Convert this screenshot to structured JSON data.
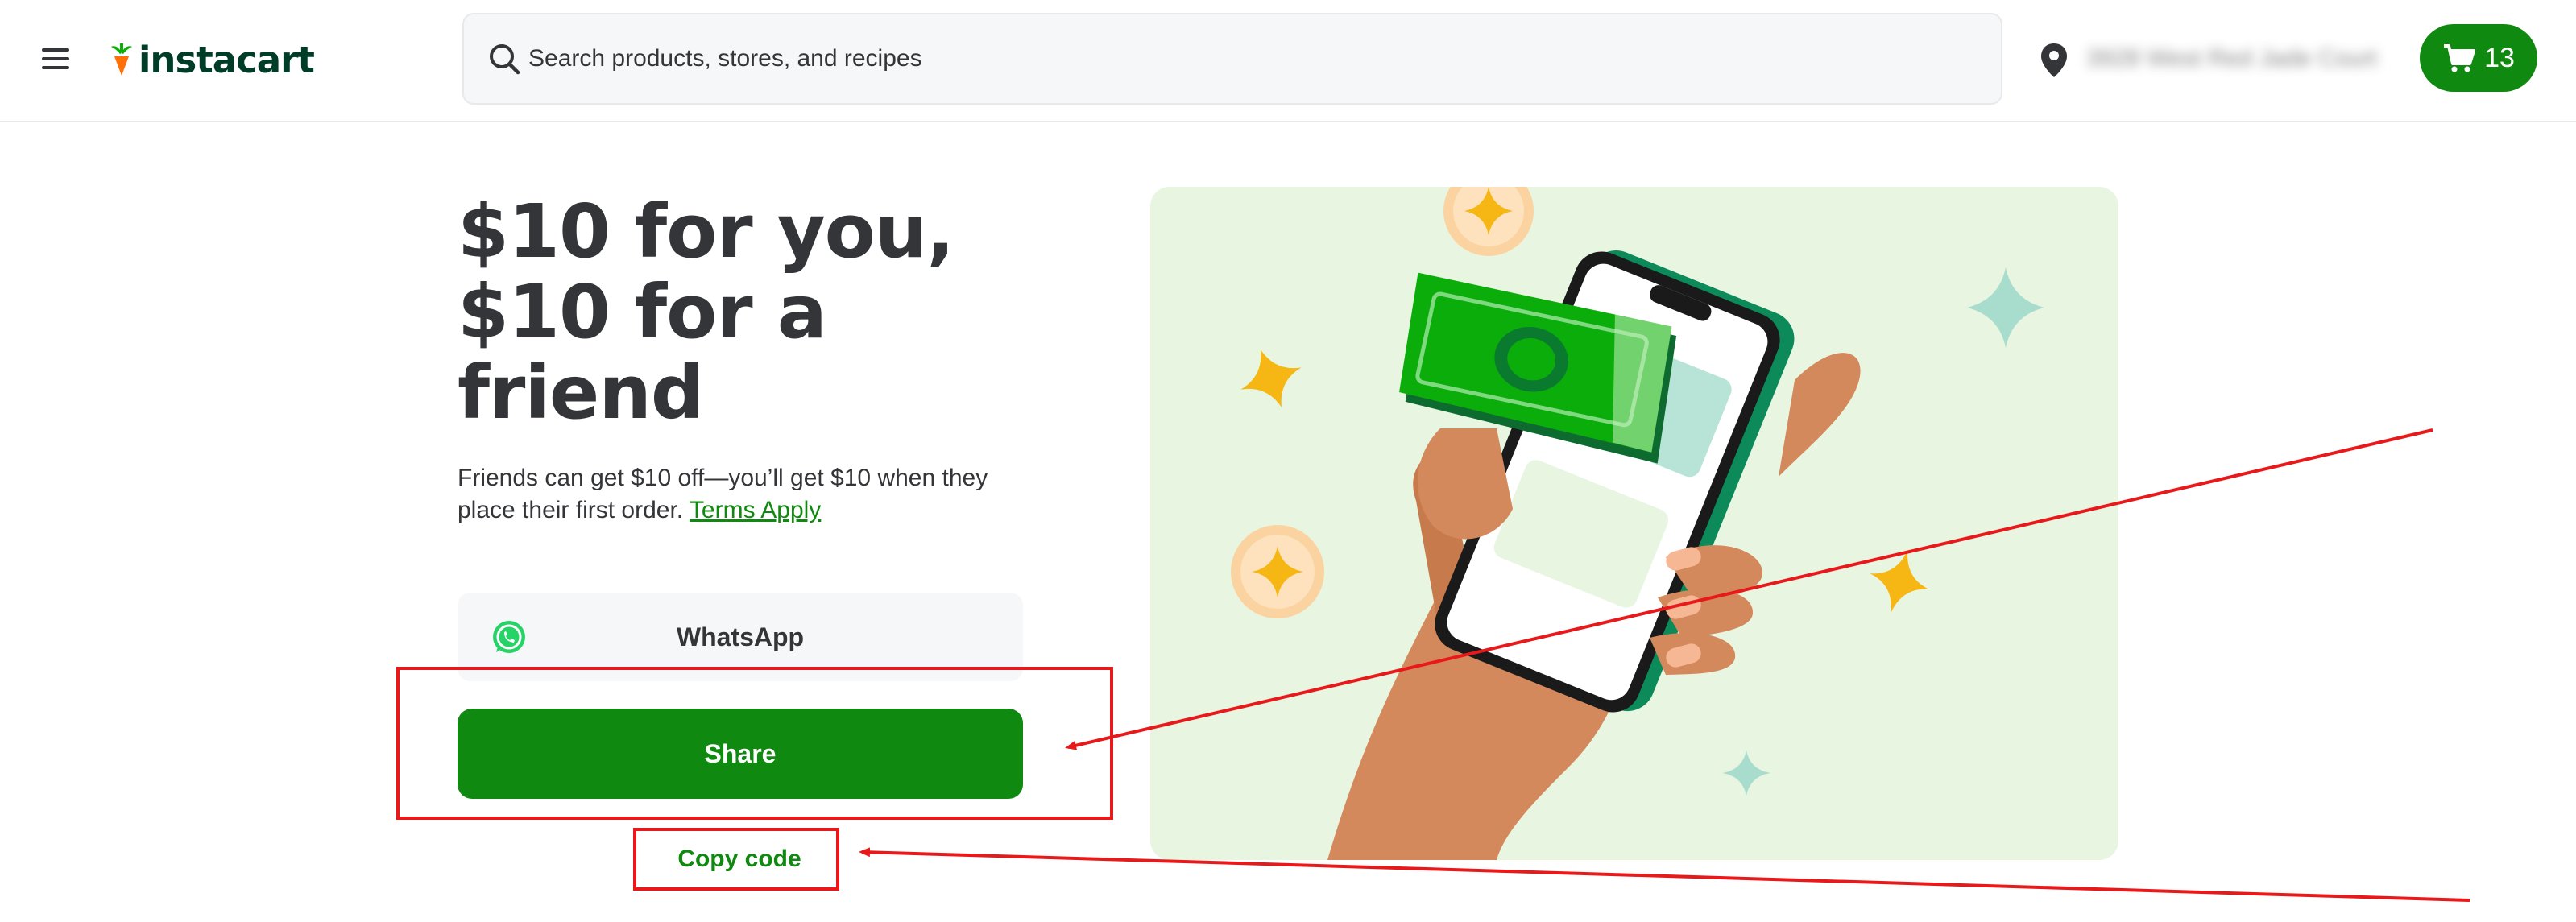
{
  "header": {
    "logo_text": "instacart",
    "search": {
      "placeholder": "Search products, stores, and recipes"
    },
    "address_blurred": "3928 West Red Jade Court",
    "cart_count": "13"
  },
  "main": {
    "headline": "$10 for you, $10 for a friend",
    "description": "Friends can get $10 off—you’ll get $10 when they place their first order.",
    "terms_link": "Terms Apply",
    "whatsapp_label": "WhatsApp",
    "share_label": "Share",
    "copy_code_label": "Copy code"
  },
  "colors": {
    "brand_green": "#108910",
    "logo_dark_green": "#003d29",
    "logo_carrot": "#ff7009",
    "illustration_bg": "#e7f5e1",
    "annotation_red": "#e8191b"
  },
  "icons": [
    "menu-icon",
    "carrot-logo-icon",
    "search-icon",
    "location-pin-icon",
    "cart-icon",
    "whatsapp-icon"
  ]
}
